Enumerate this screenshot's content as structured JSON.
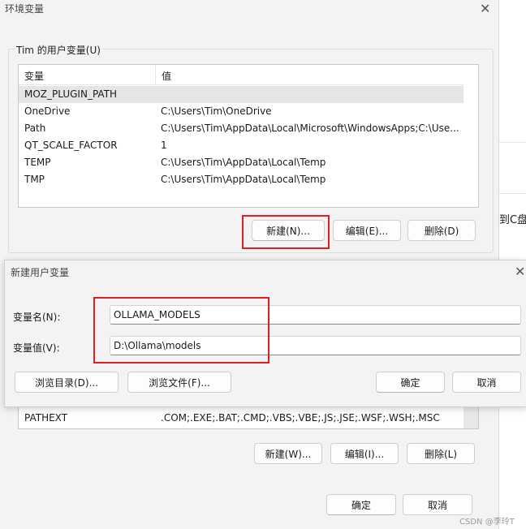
{
  "env_window": {
    "title": "环境变量",
    "close_glyph": "✕",
    "user_group_label": "Tim 的用户变量(U)",
    "columns": [
      "变量",
      "值"
    ],
    "user_vars": [
      {
        "name": "MOZ_PLUGIN_PATH",
        "value": ""
      },
      {
        "name": "OneDrive",
        "value": "C:\\Users\\Tim\\OneDrive"
      },
      {
        "name": "Path",
        "value": "C:\\Users\\Tim\\AppData\\Local\\Microsoft\\WindowsApps;C:\\Use..."
      },
      {
        "name": "QT_SCALE_FACTOR",
        "value": "1"
      },
      {
        "name": "TEMP",
        "value": "C:\\Users\\Tim\\AppData\\Local\\Temp"
      },
      {
        "name": "TMP",
        "value": "C:\\Users\\Tim\\AppData\\Local\\Temp"
      }
    ],
    "user_buttons": {
      "new": "新建(N)...",
      "edit": "编辑(E)...",
      "delete": "删除(D)"
    },
    "system_vars_visible": [
      {
        "name": "PATHEXT",
        "value": ".COM;.EXE;.BAT;.CMD;.VBS;.VBE;.JS;.JSE;.WSF;.WSH;.MSC"
      }
    ],
    "system_buttons": {
      "new": "新建(W)...",
      "edit": "编辑(I)...",
      "delete": "删除(L)"
    },
    "ok": "确定",
    "cancel": "取消"
  },
  "background_text": "到C盘",
  "new_var_dialog": {
    "title": "新建用户变量",
    "close_glyph": "✕",
    "name_label": "变量名(N):",
    "name_value": "OLLAMA_MODELS",
    "value_label": "变量值(V):",
    "value_value": "D:\\Ollama\\models",
    "browse_dir": "浏览目录(D)...",
    "browse_file": "浏览文件(F)...",
    "ok": "确定",
    "cancel": "取消"
  },
  "watermark": "CSDN @李玲T"
}
